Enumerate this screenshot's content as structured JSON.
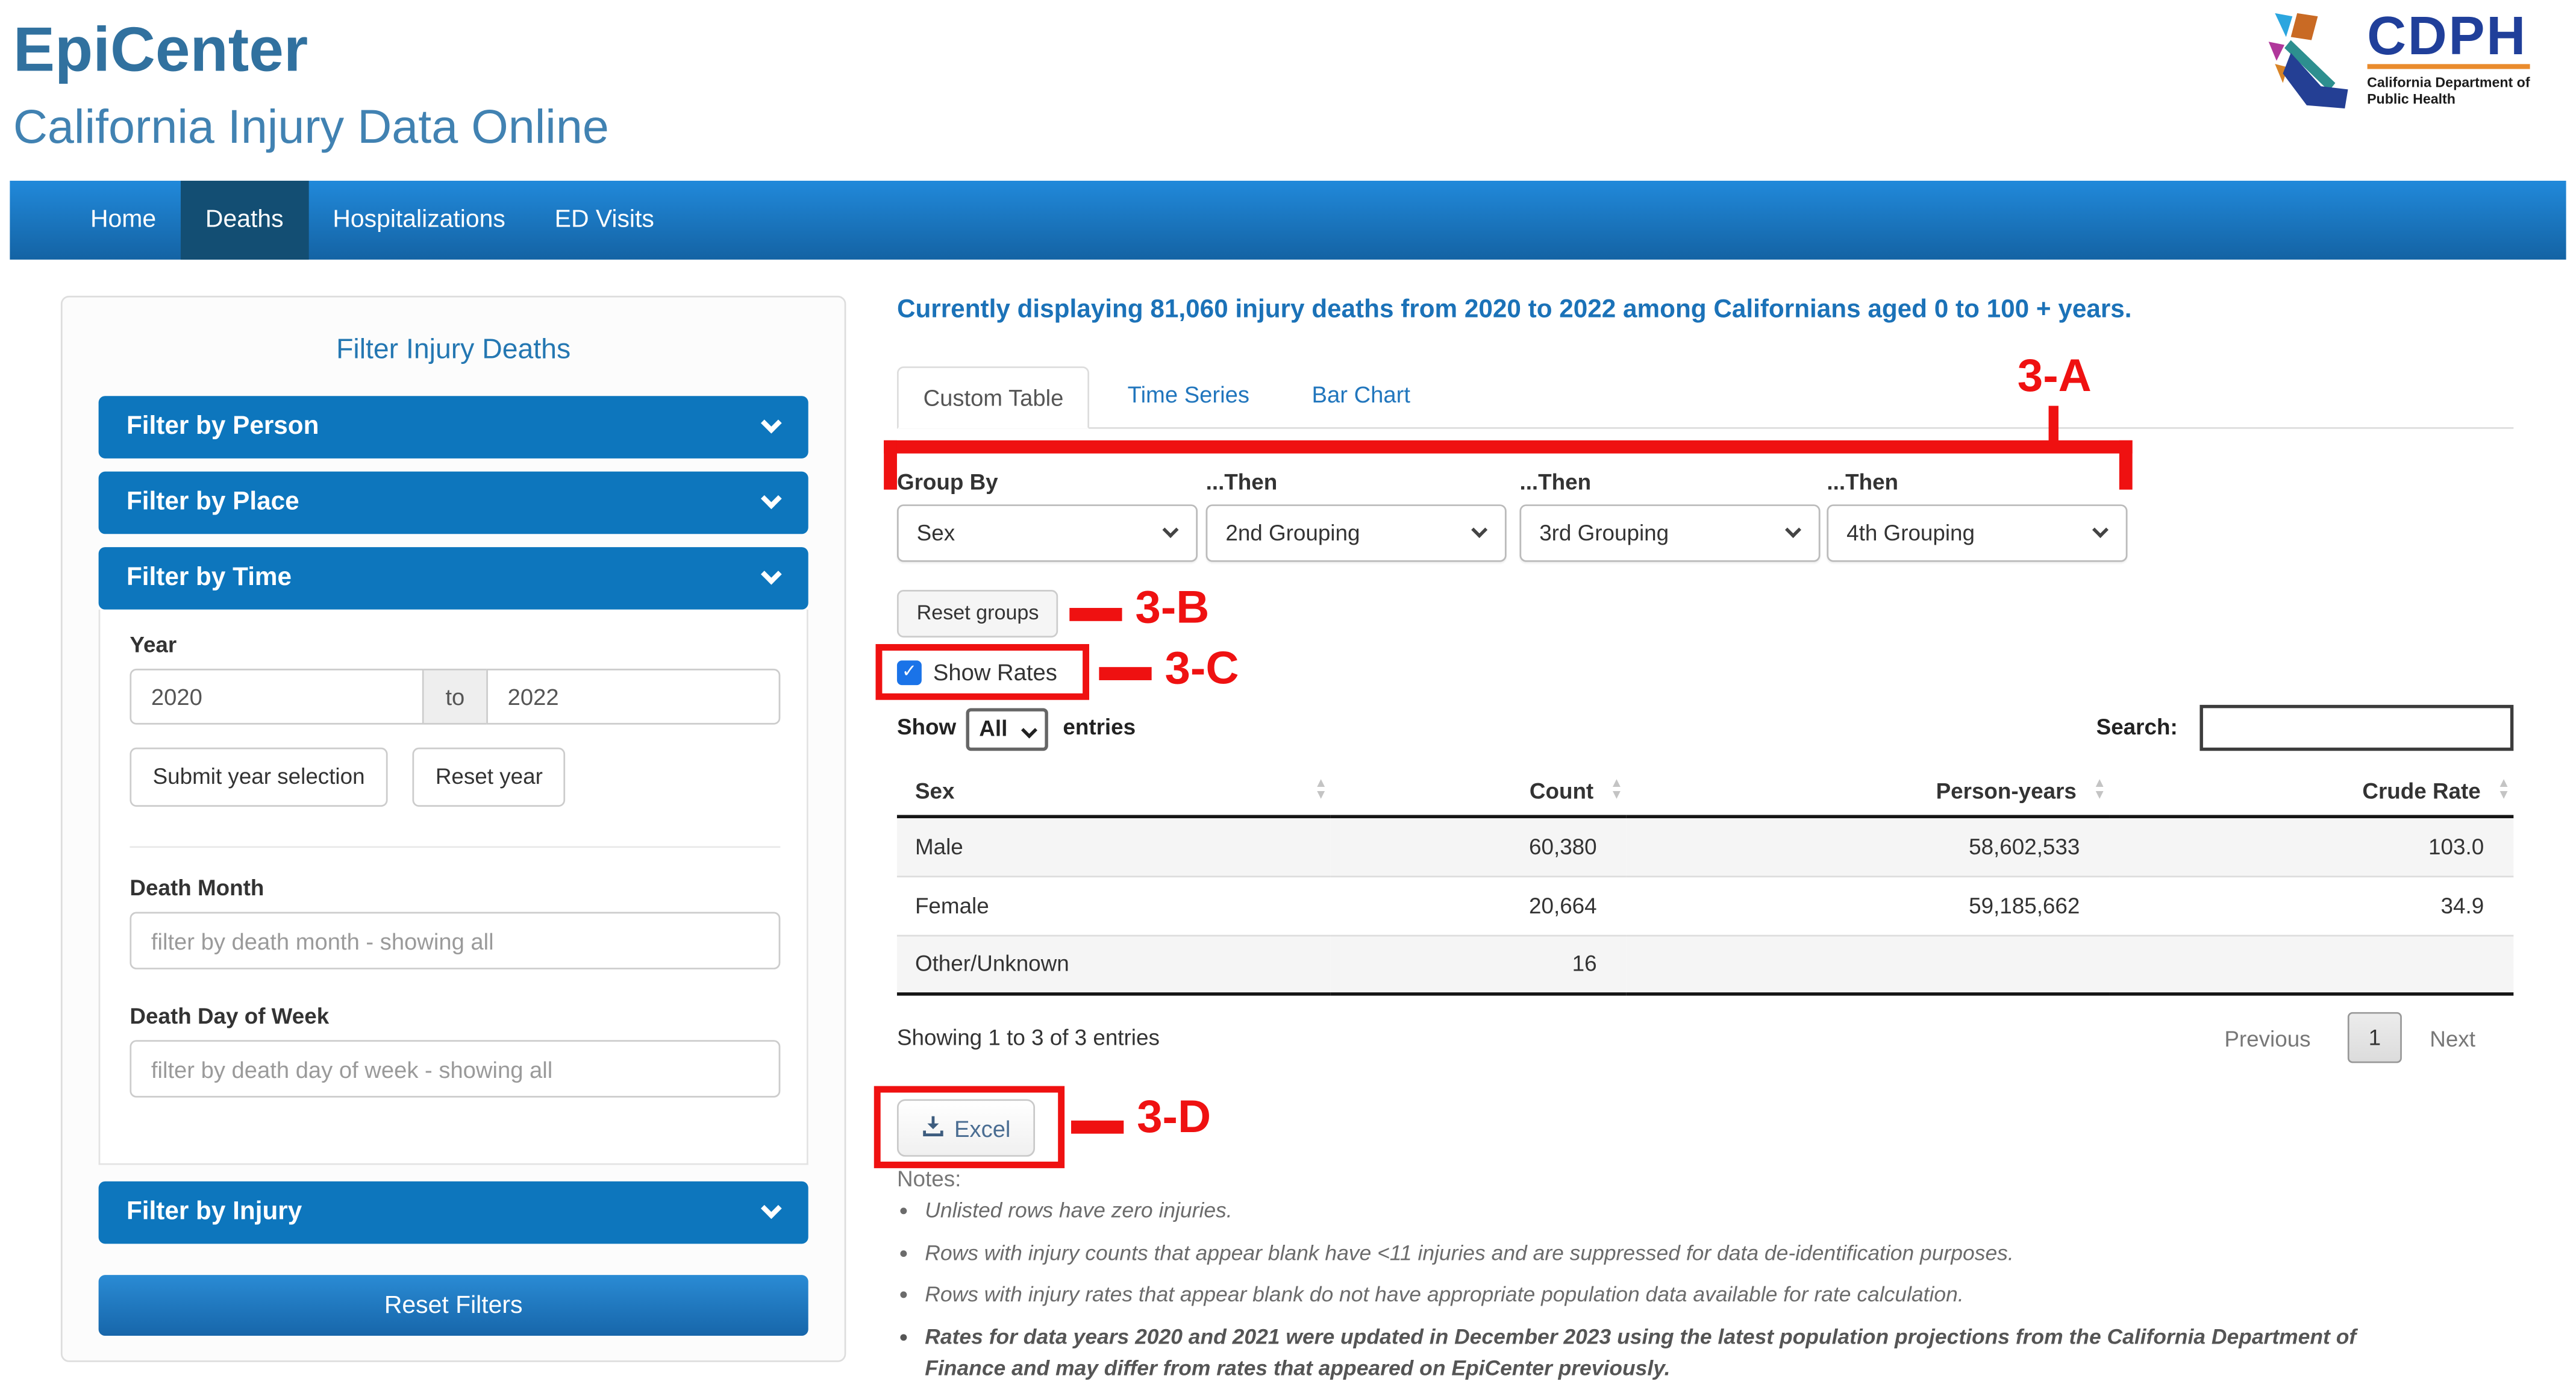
{
  "header": {
    "title": "EpiCenter",
    "subtitle": "California Injury Data Online",
    "logo": {
      "acronym": "CDPH",
      "org_line1": "California Department of",
      "org_line2": "Public Health"
    }
  },
  "nav": {
    "items": [
      {
        "label": "Home"
      },
      {
        "label": "Deaths"
      },
      {
        "label": "Hospitalizations"
      },
      {
        "label": "ED Visits"
      }
    ]
  },
  "sidebar": {
    "title": "Filter Injury Deaths",
    "sections": [
      {
        "label": "Filter by Person"
      },
      {
        "label": "Filter by Place"
      },
      {
        "label": "Filter by Time"
      },
      {
        "label": "Filter by Injury"
      }
    ],
    "time": {
      "year_label": "Year",
      "year_from": "2020",
      "year_separator": "to",
      "year_to": "2022",
      "submit_button": "Submit year selection",
      "reset_button": "Reset year",
      "death_month_label": "Death Month",
      "death_month_placeholder": "filter by death month - showing all",
      "death_dow_label": "Death Day of Week",
      "death_dow_placeholder": "filter by death day of week - showing all"
    },
    "reset_filters_button": "Reset Filters"
  },
  "main": {
    "summary": "Currently displaying 81,060 injury deaths from 2020 to 2022 among Californians aged 0 to 100 + years.",
    "tabs": [
      {
        "label": "Custom Table"
      },
      {
        "label": "Time Series"
      },
      {
        "label": "Bar Chart"
      }
    ],
    "grouping": {
      "labels": [
        "Group By",
        "...Then",
        "...Then",
        "...Then"
      ],
      "selects": [
        "Sex",
        "2nd Grouping",
        "3rd Grouping",
        "4th Grouping"
      ],
      "reset_button": "Reset groups"
    },
    "show_rates_label": "Show Rates",
    "entries": {
      "show": "Show",
      "selected": "All",
      "entries": "entries"
    },
    "search_label": "Search:",
    "table": {
      "columns": [
        "Sex",
        "Count",
        "Person-years",
        "Crude Rate"
      ],
      "rows": [
        {
          "sex": "Male",
          "count": "60,380",
          "person_years": "58,602,533",
          "crude_rate": "103.0"
        },
        {
          "sex": "Female",
          "count": "20,664",
          "person_years": "59,185,662",
          "crude_rate": "34.9"
        },
        {
          "sex": "Other/Unknown",
          "count": "16",
          "person_years": "",
          "crude_rate": ""
        }
      ],
      "info": "Showing 1 to 3 of 3 entries",
      "pagination": {
        "previous": "Previous",
        "page": "1",
        "next": "Next"
      }
    },
    "excel_button": "Excel",
    "notes": {
      "heading": "Notes:",
      "items": [
        {
          "text": "Unlisted rows have zero injuries."
        },
        {
          "text": "Rows with injury counts that appear blank have <11 injuries and are suppressed for data de-identification purposes."
        },
        {
          "text": "Rows with injury rates that appear blank do not have appropriate population data available for rate calculation."
        },
        {
          "text": "Rates for data years 2020 and 2021 were updated in December 2023 using the latest population projections from the California Department of Finance and may differ from rates that appeared on EpiCenter previously."
        }
      ]
    },
    "annotations": {
      "a": "3-A",
      "b": "3-B",
      "c": "3-C",
      "d": "3-D"
    }
  },
  "colors": {
    "accent_blue": "#0d76bd",
    "nav_active": "#134e73",
    "link_blue": "#2176bd",
    "annotation_red": "#ef1111",
    "header_blue": "#31719f"
  }
}
